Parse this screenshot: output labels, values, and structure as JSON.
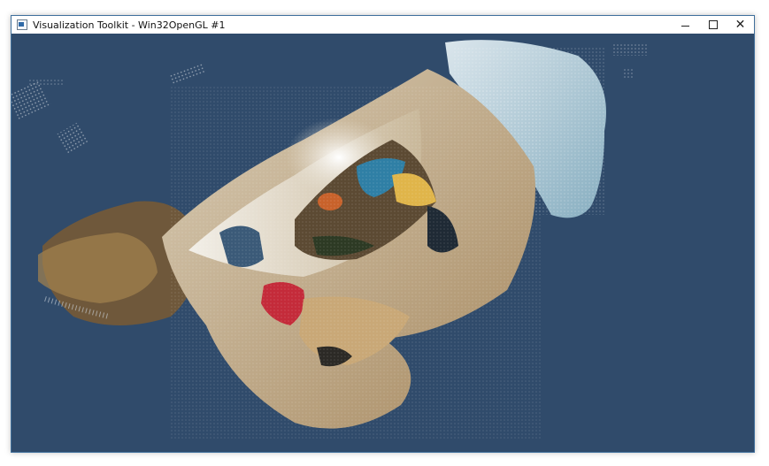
{
  "window": {
    "title": "Visualization Toolkit - Win32OpenGL #1",
    "icon": "vtk-window-icon",
    "controls": {
      "minimize": "minimize-icon",
      "maximize": "maximize-icon",
      "close": "close-icon"
    }
  },
  "viewport": {
    "background_color": "#304b6b",
    "content": "3d-point-cloud-render"
  }
}
